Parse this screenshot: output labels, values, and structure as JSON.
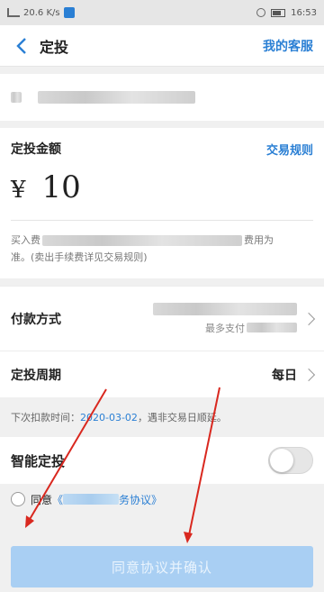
{
  "status_bar": {
    "left_text": "20.6 K/s",
    "time": "16:53"
  },
  "header": {
    "title": "定投",
    "service_link": "我的客服"
  },
  "amount_card": {
    "label": "定投金额",
    "rules_link": "交易规则",
    "currency": "¥",
    "value": "10",
    "fee_prefix": "买入费",
    "fee_suffix": "费用为",
    "fee_line2": "准。(卖出手续费详见交易规则)"
  },
  "payment": {
    "label": "付款方式",
    "note_prefix": "最多支付"
  },
  "period": {
    "label": "定投周期",
    "value": "每日"
  },
  "next_debit": {
    "prefix": "下次扣款时间：",
    "date": "2020-03-02",
    "suffix": "，遇非交易日顺延。"
  },
  "smart": {
    "label": "智能定投"
  },
  "agreement": {
    "prefix": "同意",
    "open": "《",
    "suffix": "务协议",
    "close": "》"
  },
  "confirm_button": {
    "label": "同意协议并确认"
  },
  "colors": {
    "accent": "#2a7fd4",
    "button_disabled": "#a9cff3",
    "annotation_arrow": "#d9281f"
  }
}
